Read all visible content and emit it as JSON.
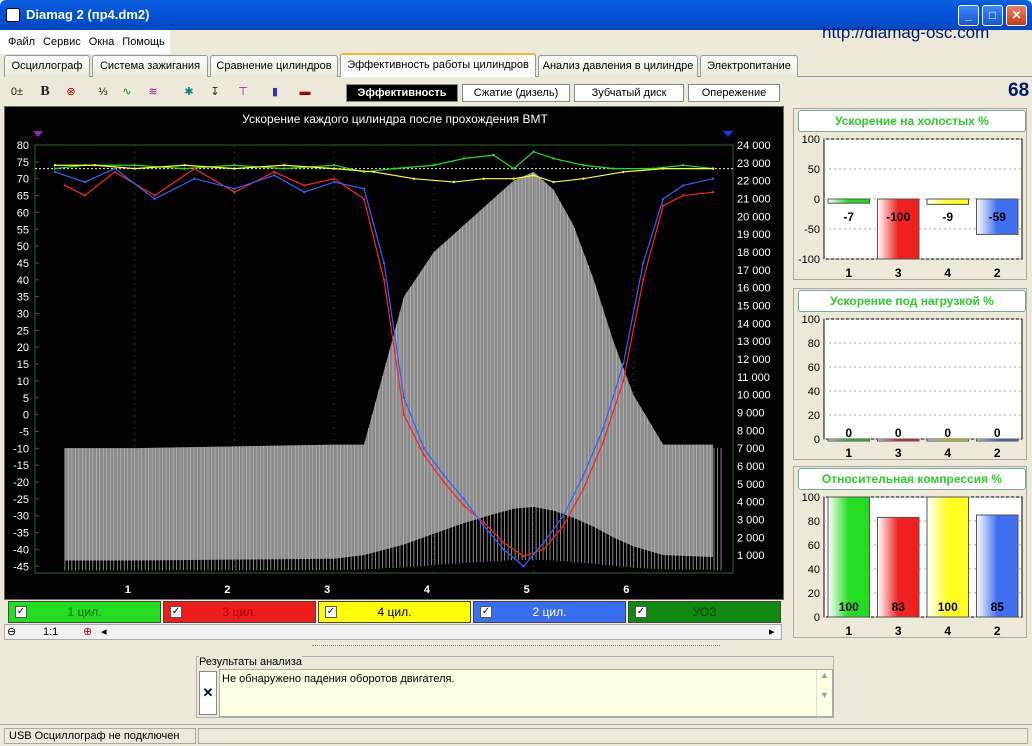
{
  "window": {
    "title": "Diamag 2 (пр4.dm2)",
    "url": "http://diamag-osc.com"
  },
  "menu": [
    "Файл",
    "Сервис",
    "Окна",
    "Помощь"
  ],
  "tabs": [
    "Осциллограф",
    "Система зажигания",
    "Сравнение цилиндров",
    "Эффективность работы цилиндров",
    "Анализ давления в цилиндре",
    "Электропитание"
  ],
  "active_tab": 3,
  "subtabs": [
    "Эффективность",
    "Сжатие (дизель)",
    "Зубчатый диск",
    "Опережение"
  ],
  "active_subtab": 0,
  "toolbar_value": "68",
  "chart_data": [
    {
      "type": "line",
      "title": "Ускорение каждого цилиндра после прохождения ВМТ",
      "xlabel": "",
      "ylabel": "",
      "x_ticks": [
        "1",
        "2",
        "3",
        "4",
        "5",
        "6"
      ],
      "y_left": {
        "min": -47,
        "max": 80,
        "ticks": [
          80,
          75,
          70,
          65,
          60,
          55,
          50,
          45,
          40,
          35,
          30,
          25,
          20,
          15,
          10,
          5,
          0,
          -5,
          -10,
          -15,
          -20,
          -25,
          -30,
          -35,
          -40,
          -45
        ]
      },
      "y_right": {
        "min": 0,
        "max": 24000,
        "ticks": [
          "24 000",
          "23 000",
          "22 000",
          "21 000",
          "20 000",
          "19 000",
          "18 000",
          "17 000",
          "16 000",
          "15 000",
          "14 000",
          "13 000",
          "12 000",
          "11 000",
          "10 000",
          "9 000",
          "8 000",
          "7 000",
          "6 000",
          "5 000",
          "4 000",
          "3 000",
          "2 000",
          "1 000"
        ]
      },
      "envelope": {
        "x": [
          0.3,
          1,
          2,
          3,
          3.3,
          3.7,
          4,
          4.3,
          4.6,
          4.8,
          5,
          5.2,
          5.4,
          5.6,
          5.8,
          6,
          6.3,
          6.8
        ],
        "upper": [
          7000,
          7000,
          7100,
          7200,
          7200,
          15500,
          18000,
          19500,
          21000,
          22000,
          22500,
          21500,
          19500,
          16500,
          13000,
          10000,
          7200,
          7200
        ],
        "lower": [
          700,
          700,
          750,
          800,
          1000,
          1600,
          2200,
          2800,
          3300,
          3600,
          3700,
          3500,
          3100,
          2600,
          2000,
          1500,
          1000,
          900
        ]
      },
      "series": [
        {
          "name": "1 цил.",
          "color": "#22dd22",
          "x": [
            0.2,
            0.5,
            1,
            1.5,
            2,
            2.5,
            3,
            3.3,
            3.6,
            4,
            4.3,
            4.6,
            4.8,
            5,
            5.2,
            5.5,
            5.8,
            6.2,
            6.5,
            6.8
          ],
          "y": [
            73,
            74,
            74,
            73,
            74,
            73,
            74,
            72,
            73,
            74,
            76,
            77,
            73,
            78,
            76,
            74,
            73,
            73,
            74,
            73
          ]
        },
        {
          "name": "3 цил.",
          "color": "#ff2020",
          "x": [
            0.3,
            0.5,
            0.8,
            1.2,
            1.6,
            2,
            2.4,
            2.7,
            3,
            3.3,
            3.5,
            3.7,
            3.9,
            4.1,
            4.3,
            4.5,
            4.7,
            4.9,
            5.1,
            5.3,
            5.5,
            5.7,
            5.9,
            6.1,
            6.3,
            6.5,
            6.8
          ],
          "y": [
            68,
            65,
            72,
            65,
            73,
            66,
            72,
            68,
            70,
            64,
            40,
            0,
            -12,
            -20,
            -27,
            -32,
            -38,
            -42,
            -40,
            -33,
            -22,
            -8,
            10,
            40,
            62,
            65,
            66
          ]
        },
        {
          "name": "4 цил.",
          "color": "#ffff20",
          "x": [
            0.2,
            0.6,
            1,
            1.5,
            2,
            2.5,
            3,
            3.4,
            3.8,
            4.2,
            4.5,
            4.8,
            5,
            5.2,
            5.5,
            5.9,
            6.3,
            6.8
          ],
          "y": [
            74,
            74,
            73,
            74,
            73,
            74,
            73,
            72,
            70,
            69,
            70,
            70,
            71,
            69,
            70,
            72,
            73,
            73
          ]
        },
        {
          "name": "2 цил.",
          "color": "#3060ff",
          "x": [
            0.2,
            0.5,
            0.8,
            1.2,
            1.6,
            2,
            2.4,
            2.7,
            3,
            3.3,
            3.5,
            3.7,
            3.9,
            4.1,
            4.3,
            4.5,
            4.7,
            4.9,
            5.1,
            5.3,
            5.5,
            5.7,
            5.9,
            6.1,
            6.3,
            6.5,
            6.8
          ],
          "y": [
            72,
            69,
            73,
            64,
            70,
            67,
            71,
            66,
            69,
            67,
            45,
            5,
            -10,
            -18,
            -25,
            -33,
            -40,
            -45,
            -38,
            -30,
            -18,
            -4,
            15,
            45,
            64,
            68,
            70
          ]
        },
        {
          "name": "УОЗ",
          "color": "#108010",
          "x": [],
          "y": []
        }
      ]
    },
    {
      "type": "bar",
      "title": "Ускорение на холостых %",
      "categories": [
        "1",
        "3",
        "4",
        "2"
      ],
      "values": [
        -7,
        -100,
        -9,
        -59
      ],
      "ylim": [
        -100,
        100
      ],
      "yticks": [
        "100",
        "50",
        "0",
        "-50",
        "-100"
      ]
    },
    {
      "type": "bar",
      "title": "Ускорение под нагрузкой %",
      "categories": [
        "1",
        "3",
        "4",
        "2"
      ],
      "values": [
        0,
        0,
        0,
        0
      ],
      "ylim": [
        0,
        100
      ],
      "yticks": [
        "100",
        "80",
        "60",
        "40",
        "20",
        "0"
      ]
    },
    {
      "type": "bar",
      "title": "Относительная компрессия %",
      "categories": [
        "1",
        "3",
        "4",
        "2"
      ],
      "values": [
        100,
        83,
        100,
        85
      ],
      "ylim": [
        0,
        100
      ],
      "yticks": [
        "100",
        "80",
        "60",
        "40",
        "20",
        "0"
      ]
    }
  ],
  "legend": [
    {
      "label": "1 цил.",
      "bg": "#22dd22",
      "fg": "#006600"
    },
    {
      "label": "3 цил.",
      "bg": "#ee1c1c",
      "fg": "#aa0000"
    },
    {
      "label": "4 цил.",
      "bg": "#ffff00",
      "fg": "#000000"
    },
    {
      "label": "2 цил.",
      "bg": "#3a6ef0",
      "fg": "#ffffff"
    },
    {
      "label": "УОЗ",
      "bg": "#118811",
      "fg": "#004400"
    }
  ],
  "bar_colors": [
    "#22dd22",
    "#ee2020",
    "#ffff20",
    "#4070f0"
  ],
  "zoom": "1:1",
  "results": {
    "label": "Результаты анализа",
    "text": "Не обнаружено падения оборотов двигателя."
  },
  "status": "USB Осциллограф не подключен"
}
